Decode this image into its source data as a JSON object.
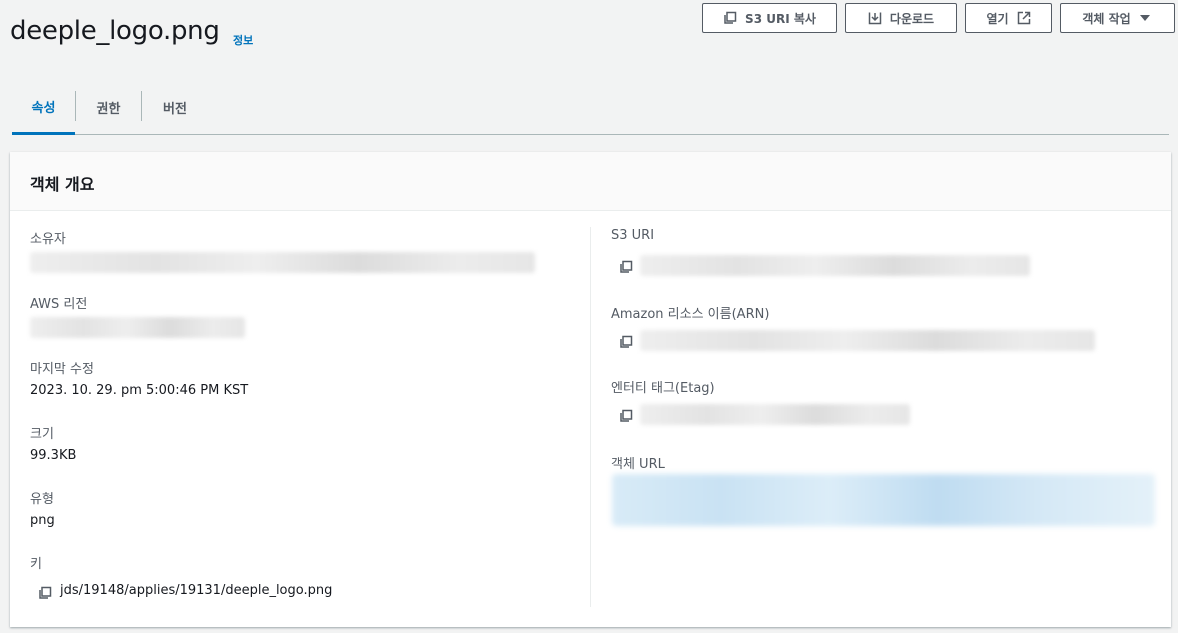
{
  "header": {
    "title": "deeple_logo.png",
    "info_link": "정보",
    "buttons": {
      "copy_s3_uri": "S3 URI 복사",
      "download": "다운로드",
      "open": "열기",
      "object_actions": "객체 작업"
    }
  },
  "tabs": [
    {
      "label": "속성",
      "active": true
    },
    {
      "label": "권한",
      "active": false
    },
    {
      "label": "버전",
      "active": false
    }
  ],
  "panel": {
    "title": "객체 개요",
    "left": {
      "owner_label": "소유자",
      "region_label": "AWS 리전",
      "last_modified_label": "마지막 수정",
      "last_modified_value": "2023. 10. 29. pm 5:00:46 PM KST",
      "size_label": "크기",
      "size_value": "99.3KB",
      "type_label": "유형",
      "type_value": "png",
      "key_label": "키",
      "key_value": "jds/19148/applies/19131/deeple_logo.png"
    },
    "right": {
      "s3_uri_label": "S3 URI",
      "arn_label": "Amazon 리소스 이름(ARN)",
      "etag_label": "엔터티 태그(Etag)",
      "object_url_label": "객체 URL"
    }
  },
  "colors": {
    "accent": "#0073bb",
    "text": "#16191f",
    "muted": "#545b64",
    "background": "#f2f3f3"
  }
}
